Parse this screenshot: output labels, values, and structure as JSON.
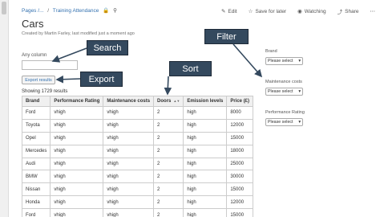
{
  "breadcrumb": {
    "pages": "Pages /...",
    "separator": "/",
    "current": "Training Attendance"
  },
  "toolbar": {
    "edit": "Edit",
    "save_for_later": "Save for later",
    "watching": "Watching",
    "share": "Share"
  },
  "page": {
    "title": "Cars",
    "byline": "Created by Martin Farley, last modified just a moment ago"
  },
  "search": {
    "label": "Any column",
    "value": ""
  },
  "export_label": "Export results",
  "results_count": "Showing 1729 results",
  "table": {
    "columns": [
      "Brand",
      "Performance Rating",
      "Maintenance costs",
      "Doors",
      "Emission levels",
      "Price (£)"
    ],
    "rows": [
      [
        "Ford",
        "vhigh",
        "vhigh",
        "2",
        "high",
        "8000"
      ],
      [
        "Toyota",
        "vhigh",
        "vhigh",
        "2",
        "high",
        "12000"
      ],
      [
        "Opel",
        "vhigh",
        "vhigh",
        "2",
        "high",
        "15000"
      ],
      [
        "Mercedes",
        "vhigh",
        "vhigh",
        "2",
        "high",
        "18000"
      ],
      [
        "Audi",
        "vhigh",
        "vhigh",
        "2",
        "high",
        "25000"
      ],
      [
        "BMW",
        "vhigh",
        "vhigh",
        "2",
        "high",
        "30000"
      ],
      [
        "Nissan",
        "vhigh",
        "vhigh",
        "2",
        "high",
        "15000"
      ],
      [
        "Honda",
        "vhigh",
        "vhigh",
        "2",
        "high",
        "12000"
      ],
      [
        "Ford",
        "vhigh",
        "vhigh",
        "2",
        "high",
        "15000"
      ]
    ]
  },
  "filters": [
    {
      "label": "Brand",
      "value": "Please select"
    },
    {
      "label": "Maintenance costs",
      "value": "Please select"
    },
    {
      "label": "Performance Rating",
      "value": "Please select"
    }
  ],
  "callouts": {
    "filter": "Filter",
    "search": "Search",
    "export": "Export",
    "sort": "Sort"
  },
  "colors": {
    "callout_bg": "#34495e",
    "link": "#3572b0",
    "header_bg": "#f0f0f0"
  }
}
